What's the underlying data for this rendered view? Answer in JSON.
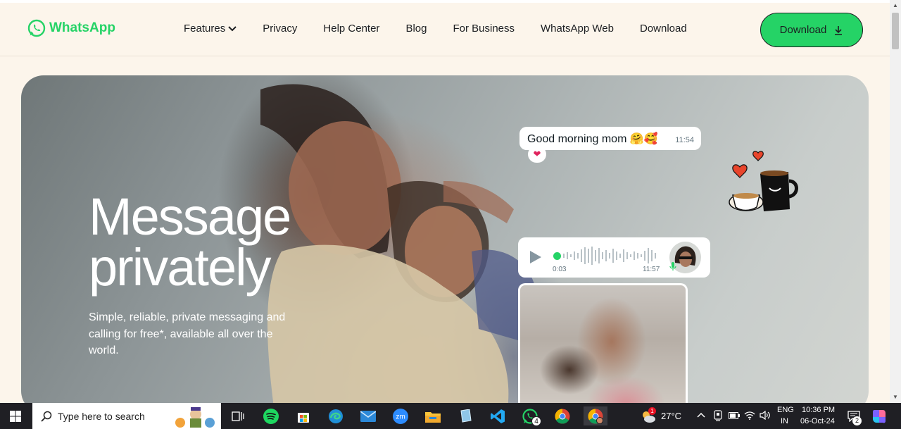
{
  "brand": {
    "name": "WhatsApp",
    "accent": "#25d366"
  },
  "nav": {
    "items": [
      {
        "label": "Features"
      },
      {
        "label": "Privacy"
      },
      {
        "label": "Help Center"
      },
      {
        "label": "Blog"
      },
      {
        "label": "For Business"
      },
      {
        "label": "WhatsApp Web"
      },
      {
        "label": "Download"
      }
    ],
    "cta_label": "Download"
  },
  "hero": {
    "title_line1": "Message",
    "title_line2": "privately",
    "subtitle": "Simple, reliable, private messaging and calling for free*, available all over the world.",
    "chat_message": "Good morning mom 🤗🥰",
    "chat_time": "11:54",
    "reaction": "❤",
    "voice_elapsed": "0:03",
    "voice_time": "11:57"
  },
  "taskbar": {
    "search_placeholder": "Type here to search",
    "weather": "27°C",
    "lang_line1": "ENG",
    "lang_line2": "IN",
    "time": "10:36 PM",
    "date": "06-Oct-24",
    "whatsapp_badge": "4",
    "notification_badge": "2",
    "weather_badge": "1"
  }
}
